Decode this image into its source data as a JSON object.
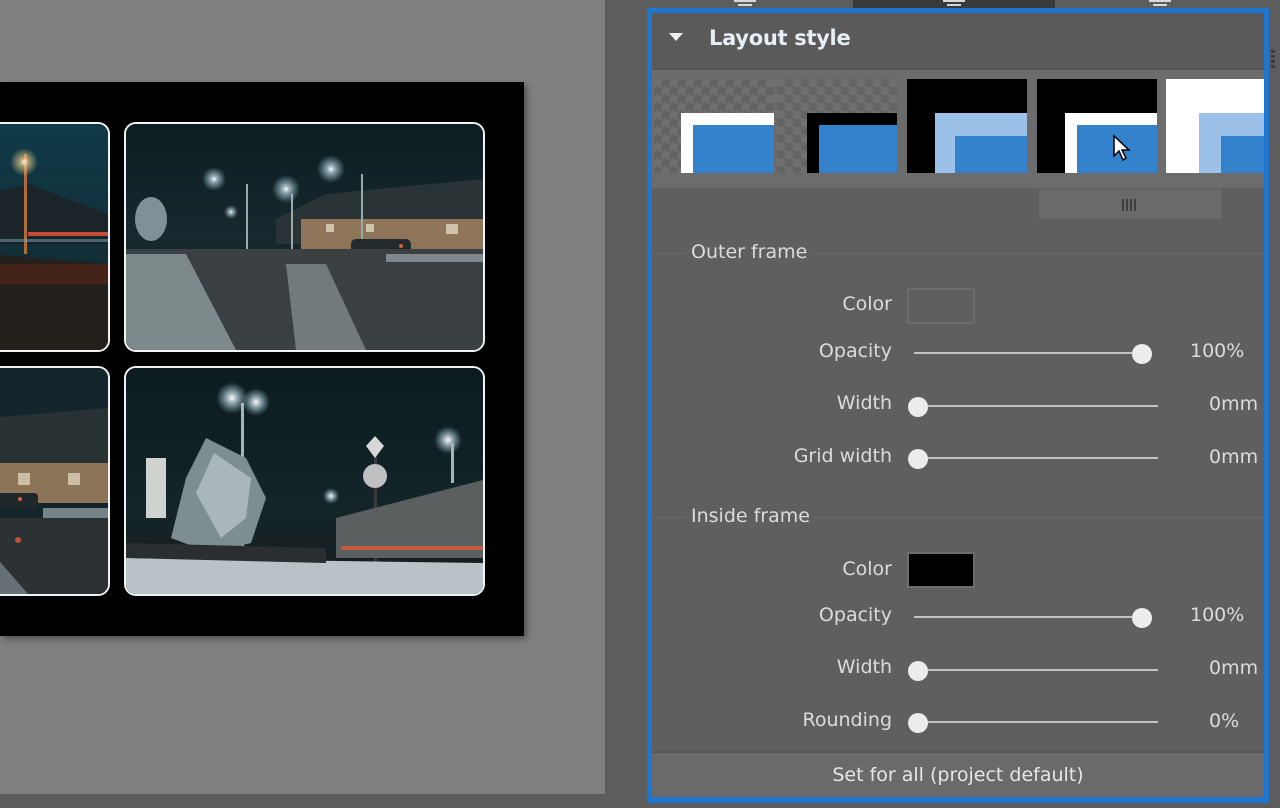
{
  "canvas": {
    "page_background": "#000000",
    "photos": [
      {
        "name": "night-street-left-top",
        "description": "Street lamp with light trails"
      },
      {
        "name": "night-street-right-top",
        "description": "Snowy street with lamps and houses"
      },
      {
        "name": "night-street-left-bottom",
        "description": "Houses and car at night"
      },
      {
        "name": "night-street-right-bottom",
        "description": "Snowy tree, street lamp and truck"
      }
    ]
  },
  "tabs": [
    {
      "icon": "align-icon"
    },
    {
      "icon": "align-icon",
      "active": true
    },
    {
      "icon": "align-icon"
    }
  ],
  "panel": {
    "title": "Layout style",
    "accent_color": "#1f76d1",
    "styles": [
      {
        "id": "transparent-white-frame",
        "outer": "transparent",
        "inner": "#ffffff"
      },
      {
        "id": "transparent-black-frame",
        "outer": "transparent",
        "inner": "#000000"
      },
      {
        "id": "black-light-blue",
        "outer": "#000000",
        "inner": "#9cc1e8"
      },
      {
        "id": "black-white-frame",
        "outer": "#000000",
        "inner": "#ffffff",
        "hovered": true
      },
      {
        "id": "white-light-blue",
        "outer": "#ffffff",
        "inner": "#9cc1e8"
      }
    ],
    "outer_frame": {
      "title": "Outer frame",
      "color_label": "Color",
      "color_value": "transparent",
      "opacity_label": "Opacity",
      "opacity_value": "100%",
      "opacity_fraction": 1.0,
      "width_label": "Width",
      "width_value": "0mm",
      "width_fraction": 0.0,
      "grid_width_label": "Grid width",
      "grid_width_value": "0mm",
      "grid_width_fraction": 0.0
    },
    "inside_frame": {
      "title": "Inside frame",
      "color_label": "Color",
      "color_value": "#000000",
      "opacity_label": "Opacity",
      "opacity_value": "100%",
      "opacity_fraction": 1.0,
      "width_label": "Width",
      "width_value": "0mm",
      "width_fraction": 0.0,
      "rounding_label": "Rounding",
      "rounding_value": "0%",
      "rounding_fraction": 0.0
    },
    "set_all_label": "Set for all (project default)"
  }
}
